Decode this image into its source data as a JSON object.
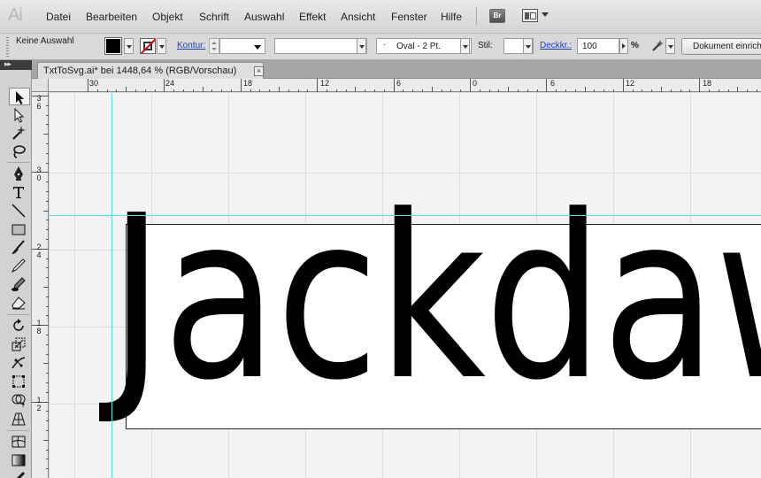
{
  "app": {
    "logo": "Ai"
  },
  "menu": [
    "Datei",
    "Bearbeiten",
    "Objekt",
    "Schrift",
    "Auswahl",
    "Effekt",
    "Ansicht",
    "Fenster",
    "Hilfe"
  ],
  "menubar_buttons": {
    "bridge": "Br"
  },
  "control_bar": {
    "selection_status": "Keine Auswahl",
    "stroke_label": "Kontur:",
    "brush": "Oval - 2 Pt.",
    "style_label": "Stil:",
    "opacity_label": "Deckkr.:",
    "opacity_value": "100",
    "percent": "%",
    "doc_setup_button": "Dokument einrichten"
  },
  "toolbox_header": "▸▸",
  "document_tab": {
    "title": "TxtToSvg.ai* bei 1448,64 % (RGB/Vorschau)",
    "close": "×"
  },
  "ruler_top_labels": [
    "30",
    "24",
    "18",
    "12",
    "6",
    "0",
    "6",
    "12",
    "18"
  ],
  "ruler_left_labels": [
    "36",
    "30",
    "24",
    "18",
    "12"
  ],
  "artwork": {
    "text": "Jackdaw"
  },
  "tools": [
    "selection-tool",
    "direct-selection-tool",
    "magic-wand-tool",
    "lasso-tool",
    "pen-tool",
    "type-tool",
    "line-segment-tool",
    "rectangle-tool",
    "paintbrush-tool",
    "pencil-tool",
    "blob-brush-tool",
    "eraser-tool",
    "rotate-tool",
    "scale-tool",
    "width-tool",
    "free-transform-tool",
    "shape-builder-tool",
    "perspective-grid-tool",
    "mesh-tool",
    "gradient-tool",
    "eyedropper-tool"
  ],
  "colors": {
    "guide": "#5fdcdc",
    "link": "#1a3dbf",
    "fill": "#000000"
  }
}
